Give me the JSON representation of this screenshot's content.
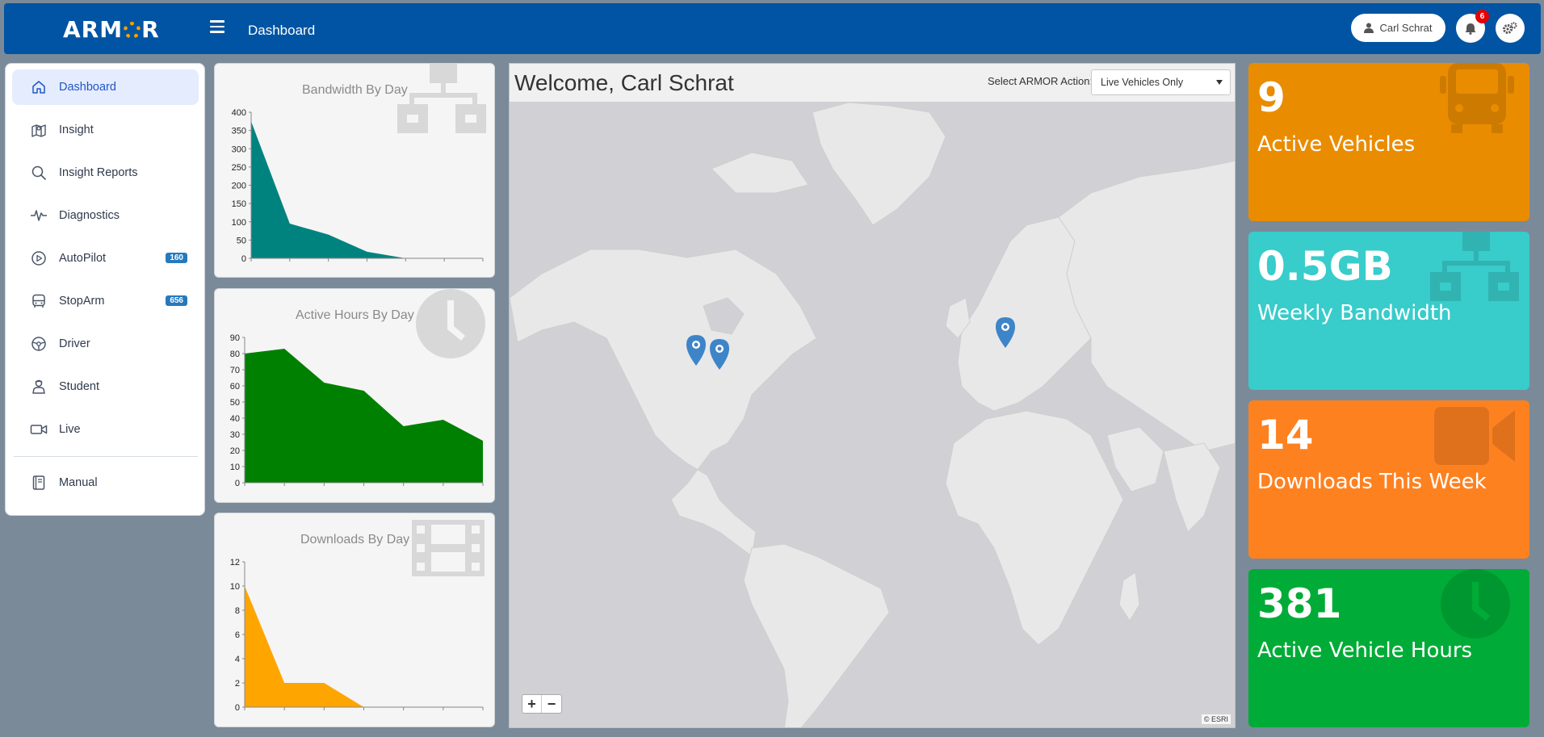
{
  "app": {
    "logo": "ARM",
    "logo_tail": "R"
  },
  "header": {
    "title": "Dashboard",
    "user_name": "Carl Schrat",
    "notification_count": "6"
  },
  "sidebar": {
    "items": [
      {
        "label": "Dashboard",
        "icon": "home-icon",
        "active": true
      },
      {
        "label": "Insight",
        "icon": "map-icon"
      },
      {
        "label": "Insight Reports",
        "icon": "search-icon"
      },
      {
        "label": "Diagnostics",
        "icon": "pulse-icon"
      },
      {
        "label": "AutoPilot",
        "icon": "play-icon",
        "badge": "160"
      },
      {
        "label": "StopArm",
        "icon": "bus-icon",
        "badge": "656"
      },
      {
        "label": "Driver",
        "icon": "steering-wheel-icon"
      },
      {
        "label": "Student",
        "icon": "student-icon"
      },
      {
        "label": "Live",
        "icon": "video-icon"
      },
      {
        "label": "Manual",
        "icon": "book-icon"
      }
    ]
  },
  "charts": {
    "bandwidth": {
      "title": "Bandwidth By Day",
      "chart_data": {
        "type": "area",
        "title": "Bandwidth By Day",
        "values": [
          375,
          95,
          65,
          18,
          0,
          0,
          0
        ],
        "yticks": [
          0,
          50,
          100,
          150,
          200,
          250,
          300,
          350,
          400
        ],
        "ylim": [
          0,
          400
        ],
        "color": "#00837f"
      }
    },
    "active_hours": {
      "title": "Active Hours By Day",
      "chart_data": {
        "type": "area",
        "title": "Active Hours By Day",
        "values": [
          80,
          83,
          62,
          57,
          35,
          39,
          26
        ],
        "yticks": [
          0,
          10,
          20,
          30,
          40,
          50,
          60,
          70,
          80,
          90
        ],
        "ylim": [
          0,
          90
        ],
        "color": "#008000"
      }
    },
    "downloads": {
      "title": "Downloads By Day",
      "chart_data": {
        "type": "area",
        "title": "Downloads By Day",
        "values": [
          10,
          2,
          2,
          0,
          0,
          0,
          0
        ],
        "yticks": [
          0,
          2,
          4,
          6,
          8,
          10,
          12
        ],
        "ylim": [
          0,
          12
        ],
        "color": "#ffa500"
      }
    }
  },
  "map": {
    "welcome": "Welcome, Carl Schrat",
    "action_label": "Select ARMOR Action:",
    "action_value": "Live Vehicles Only",
    "zoom_in": "+",
    "zoom_out": "−",
    "attribution": "© ESRI"
  },
  "stats": [
    {
      "value": "9",
      "label": "Active Vehicles",
      "icon": "bus-icon",
      "color": "#ea8c00"
    },
    {
      "value": "0.5GB",
      "label": "Weekly Bandwidth",
      "icon": "network-icon",
      "color": "#38cccb"
    },
    {
      "value": "14",
      "label": "Downloads This Week",
      "icon": "video-camera-icon",
      "color": "#fe8120"
    },
    {
      "value": "381",
      "label": "Active Vehicle Hours",
      "icon": "clock-icon",
      "color": "#00ac37"
    }
  ]
}
